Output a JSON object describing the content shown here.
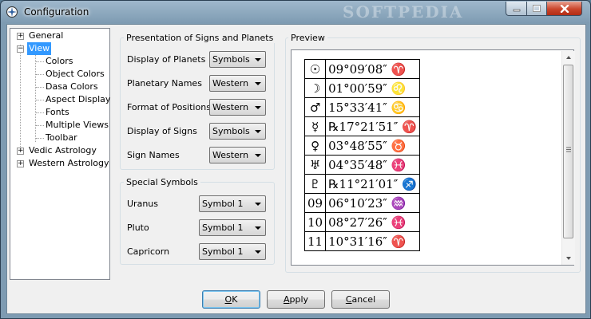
{
  "window": {
    "title": "Configuration",
    "watermark": "SOFTPEDIA"
  },
  "tree": {
    "items": [
      {
        "label": "General",
        "expander": "+"
      },
      {
        "label": "View",
        "expander": "−"
      },
      {
        "label": "Colors"
      },
      {
        "label": "Object Colors"
      },
      {
        "label": "Dasa Colors"
      },
      {
        "label": "Aspect Display"
      },
      {
        "label": "Fonts"
      },
      {
        "label": "Multiple Views"
      },
      {
        "label": "Toolbar"
      },
      {
        "label": "Vedic Astrology",
        "expander": "+"
      },
      {
        "label": "Western Astrology",
        "expander": "+"
      }
    ],
    "selected": "View"
  },
  "presentation": {
    "title": "Presentation of Signs and Planets",
    "fields": [
      {
        "label": "Display of Planets",
        "value": "Symbols"
      },
      {
        "label": "Planetary Names",
        "value": "Western"
      },
      {
        "label": "Format of Positions",
        "value": "Western"
      },
      {
        "label": "Display of Signs",
        "value": "Symbols"
      },
      {
        "label": "Sign Names",
        "value": "Western"
      }
    ]
  },
  "special": {
    "title": "Special Symbols",
    "fields": [
      {
        "label": "Uranus",
        "value": "Symbol 1"
      },
      {
        "label": "Pluto",
        "value": "Symbol 1"
      },
      {
        "label": "Capricorn",
        "value": "Symbol 1"
      }
    ]
  },
  "preview": {
    "title": "Preview",
    "rows": [
      {
        "symbol": "☉",
        "position": "09°09′08″ ♈"
      },
      {
        "symbol": "☽",
        "position": "01°00′59″ ♌"
      },
      {
        "symbol": "♂",
        "position": "15°33′41″ ♋"
      },
      {
        "symbol": "☿",
        "position": "℞17°21′51″ ♈"
      },
      {
        "symbol": "♀",
        "position": "03°48′55″ ♉"
      },
      {
        "symbol": "♅",
        "position": "04°35′48″ ♓"
      },
      {
        "symbol": "♇",
        "position": "℞11°21′01″ ♐"
      },
      {
        "symbol": "09",
        "position": "06°10′23″ ♒"
      },
      {
        "symbol": "10",
        "position": "08°27′26″ ♓"
      },
      {
        "symbol": "11",
        "position": "10°31′16″ ♈"
      }
    ]
  },
  "buttons": {
    "ok": {
      "accel": "O",
      "rest": "K"
    },
    "apply": {
      "accel": "A",
      "rest": "pply"
    },
    "cancel": {
      "accel": "C",
      "rest": "ancel"
    }
  },
  "colors": {
    "selection": "#3399ff",
    "close_button": "#c9452c"
  }
}
